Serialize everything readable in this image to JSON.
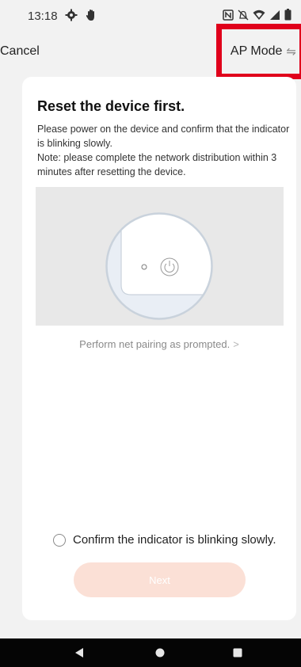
{
  "status_bar": {
    "time": "13:18",
    "icons_left": [
      "settings-gear-icon",
      "hand-icon"
    ],
    "icons_right": [
      "nfc-icon",
      "mute-icon",
      "wifi-icon",
      "signal-icon",
      "battery-icon"
    ]
  },
  "nav": {
    "cancel_label": "Cancel",
    "ap_mode_label": "AP Mode",
    "ap_mode_icon": "⇋",
    "highlight_color": "#e0001b"
  },
  "card": {
    "title": "Reset the device first.",
    "desc_line1": "Please power on the device and confirm that the indicator is blinking slowly.",
    "desc_line2": "Note: please complete the network distribution within 3 minutes after resetting the device.",
    "pair_link": "Perform net pairing as prompted.",
    "pair_chevron": ">",
    "confirm_label": "Confirm the indicator is blinking slowly.",
    "next_label": "Next",
    "next_bg_color": "#fbe0d6"
  },
  "bottom_nav": {
    "buttons": [
      "back-icon",
      "home-icon",
      "recents-icon"
    ]
  }
}
